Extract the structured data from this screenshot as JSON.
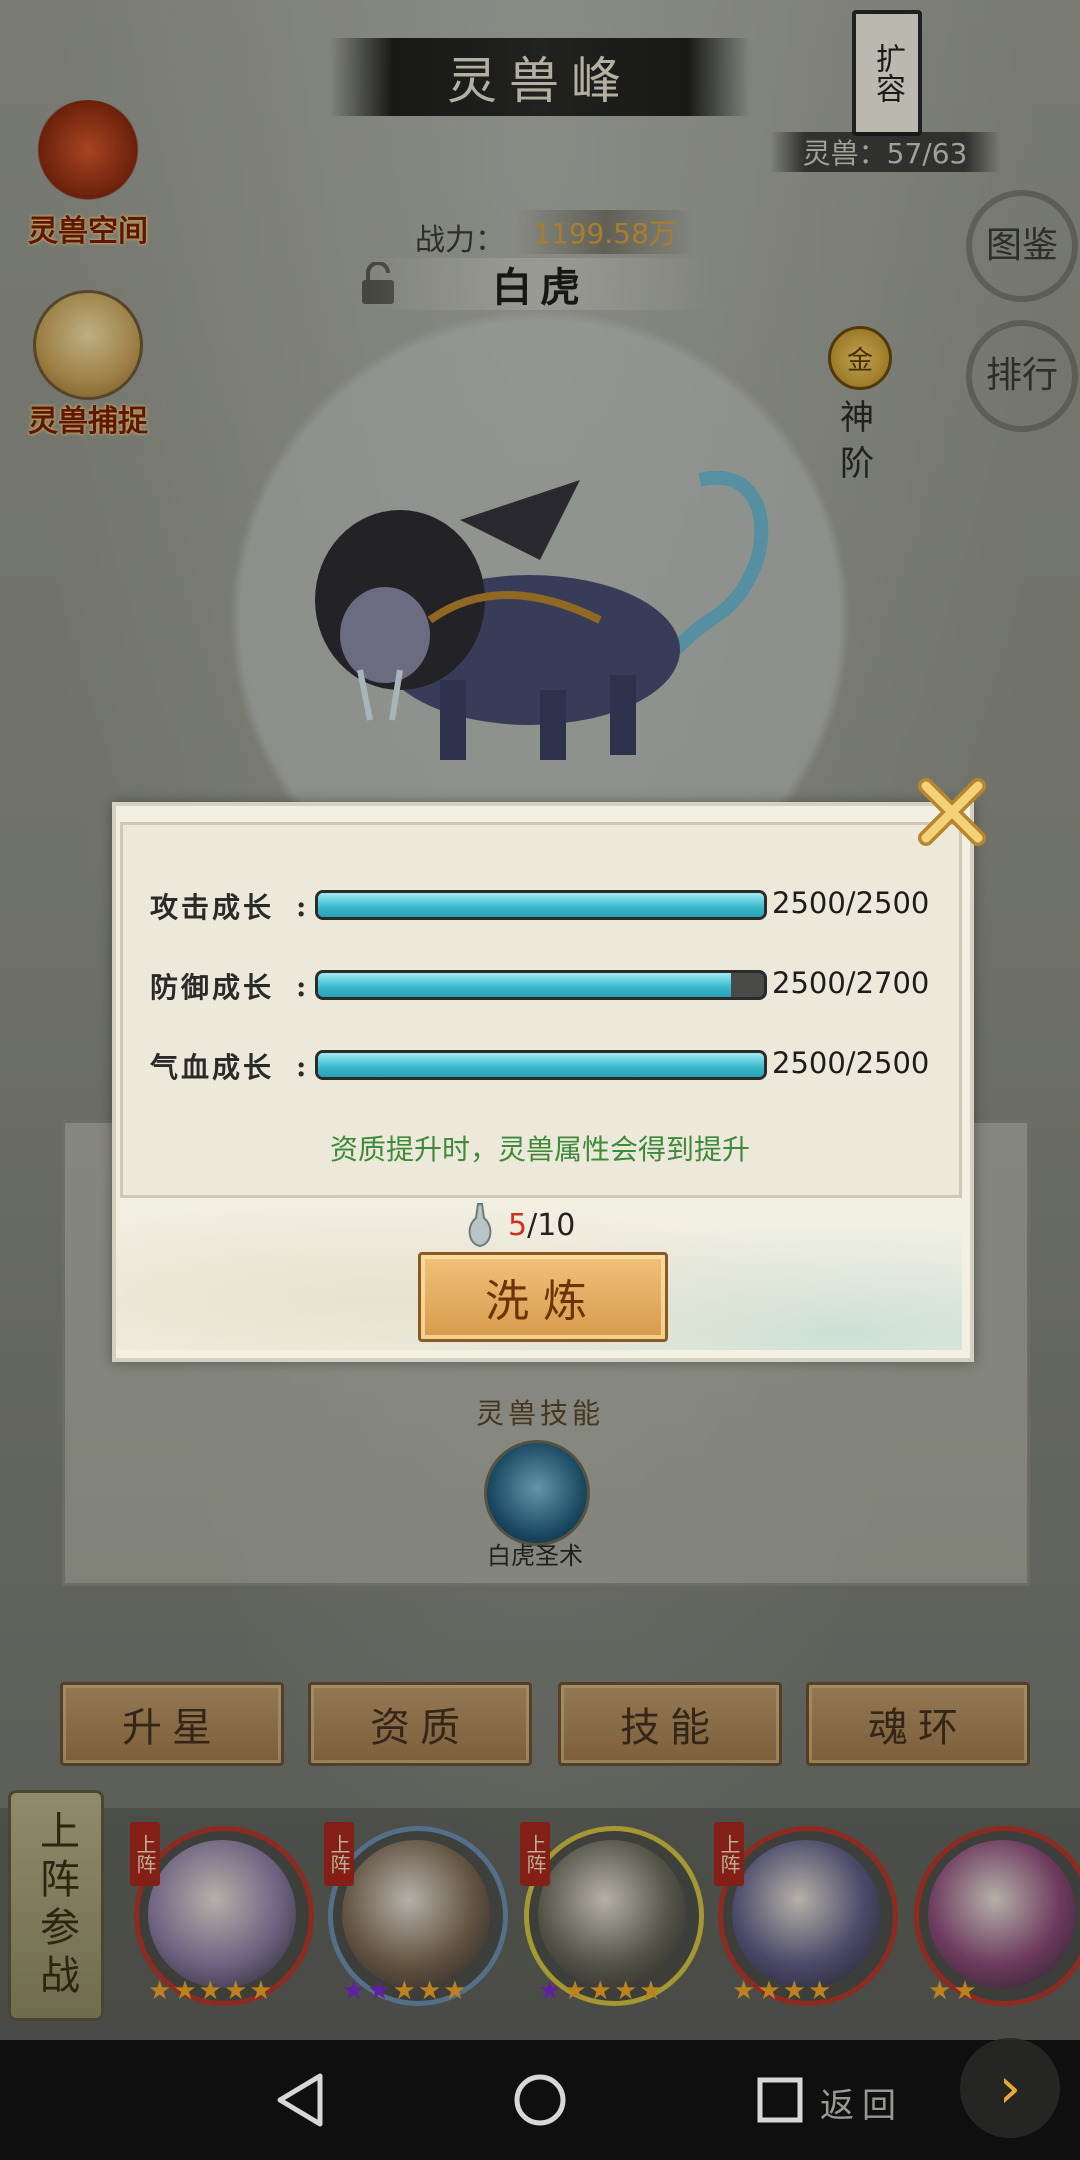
{
  "header": {
    "title": "灵兽峰",
    "expand_label": "扩容",
    "beast_count": "灵兽：57/63"
  },
  "left_menu": [
    {
      "label": "灵兽空间",
      "icon": "demon-mask-icon"
    },
    {
      "label": "灵兽捕捉",
      "icon": "capture-bowl-icon"
    }
  ],
  "right_menu": {
    "codex_label": "图鉴",
    "rank_label": "排行"
  },
  "beast": {
    "power_label": "战力：",
    "power_value": "1199.58万",
    "name": "白虎",
    "tier_badge": "金",
    "tier_text": "神阶"
  },
  "skill_section": {
    "header": "灵兽技能",
    "skill_name": "白虎圣术"
  },
  "tabs": [
    {
      "label": "升星"
    },
    {
      "label": "资质"
    },
    {
      "label": "技能"
    },
    {
      "label": "魂环"
    }
  ],
  "deploy_label": "上阵参战",
  "roster": [
    {
      "tag": "上阵",
      "stars": [
        "gold",
        "gold",
        "gold",
        "gold",
        "gold"
      ],
      "ring": "#b8362a",
      "face": "#8d7ea6"
    },
    {
      "tag": "上阵",
      "stars": [
        "purple",
        "purple",
        "gold",
        "gold",
        "gold"
      ],
      "ring": "#6b8fb0",
      "face": "#7e6a52"
    },
    {
      "tag": "上阵",
      "stars": [
        "purple",
        "gold",
        "gold",
        "gold",
        "gold"
      ],
      "ring": "#d4c240",
      "face": "#6b6a5a"
    },
    {
      "tag": "上阵",
      "stars": [
        "gold",
        "gold",
        "gold",
        "gold"
      ],
      "ring": "#b8362a",
      "face": "#5f5e86"
    },
    {
      "tag": "",
      "stars": [
        "gold",
        "gold"
      ],
      "ring": "#b8362a",
      "face": "#8c4a78"
    }
  ],
  "modal": {
    "stats": [
      {
        "label": "攻击成长",
        "value": "2500/2500",
        "fraction": 1.0
      },
      {
        "label": "防御成长",
        "value": "2500/2700",
        "fraction": 0.926
      },
      {
        "label": "气血成长",
        "value": "2500/2500",
        "fraction": 1.0
      }
    ],
    "tip": "资质提升时，灵兽属性会得到提升",
    "item_current": "5",
    "item_total": "/10",
    "refine_label": "洗炼"
  },
  "bottom": {
    "return_label": "返回"
  },
  "colors": {
    "bar_fill": "#38b8cc",
    "tip_green": "#3f8a3a",
    "count_red": "#d0321e"
  }
}
